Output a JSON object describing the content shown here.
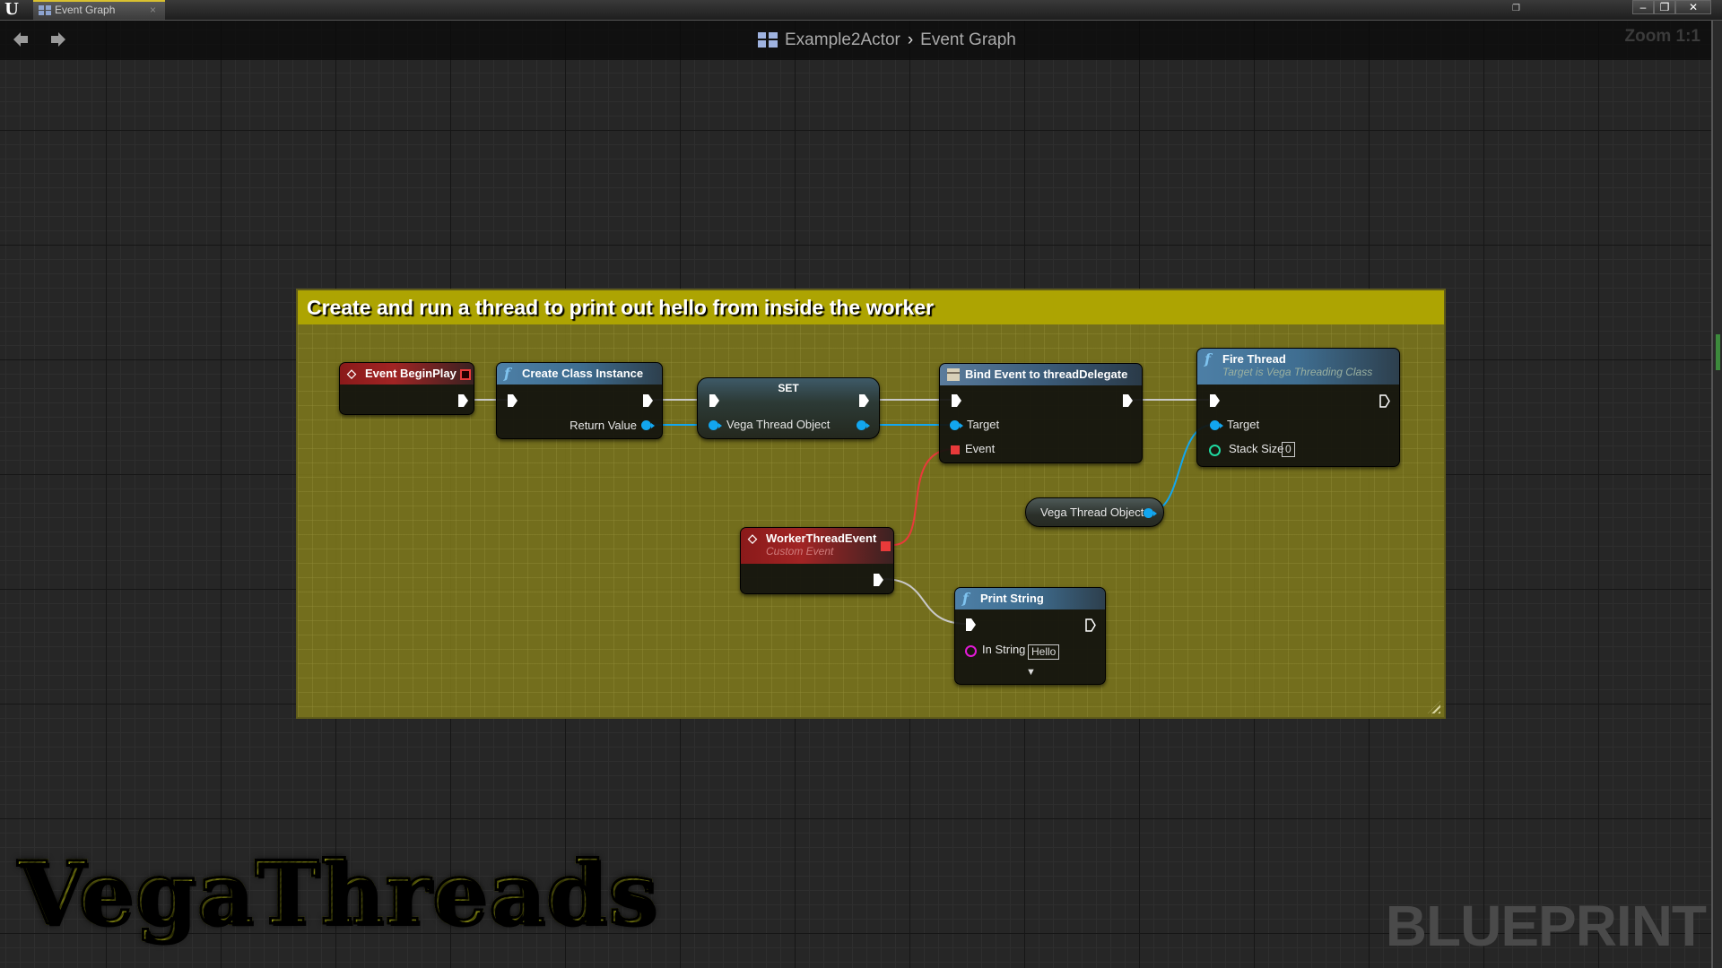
{
  "window": {
    "app_logo": "U",
    "tab_label": "Event Graph",
    "tab_close": "×",
    "controls": {
      "minimize": "–",
      "restore": "❐",
      "close": "✕"
    },
    "restore_small": "❐"
  },
  "toolbar": {
    "back_icon": "◆",
    "forward_icon": "◆",
    "breadcrumb": [
      "Example2Actor",
      "Event Graph"
    ],
    "breadcrumb_separator": "›",
    "zoom_label": "Zoom 1:1"
  },
  "comment": {
    "title": "Create and run a thread to print out hello from inside the worker",
    "color": "#ada402"
  },
  "nodes": {
    "event_begin_play": {
      "title": "Event BeginPlay",
      "icon": "◇"
    },
    "create_class_instance": {
      "title": "Create Class Instance",
      "icon": "f",
      "outputs": [
        "Return Value"
      ]
    },
    "set_node": {
      "title": "SET",
      "pin_label": "Vega Thread Object"
    },
    "bind_event": {
      "title": "Bind Event to threadDelegate",
      "inputs": [
        "Target",
        "Event"
      ]
    },
    "fire_thread": {
      "title": "Fire Thread",
      "subtitle": "Target is Vega Threading Class",
      "icon": "f",
      "inputs": [
        "Target",
        "Stack Size"
      ],
      "stack_size_value": "0"
    },
    "vega_thread_object_getter": {
      "label": "Vega Thread Object"
    },
    "worker_thread_event": {
      "title": "WorkerThreadEvent",
      "subtitle": "Custom Event",
      "icon": "◇"
    },
    "print_string": {
      "title": "Print String",
      "icon": "f",
      "input_label": "In String",
      "input_value": "Hello",
      "expand_icon": "▼"
    }
  },
  "colors": {
    "exec_wire": "#c8c8c8",
    "object_wire": "#12a6ef",
    "delegate_wire": "#e83a3a",
    "int_pin": "#1fd9a0",
    "string_pin": "#e21ad6"
  },
  "overlay": {
    "logo_text": "VegaThreads",
    "watermark": "BLUEPRINT"
  }
}
